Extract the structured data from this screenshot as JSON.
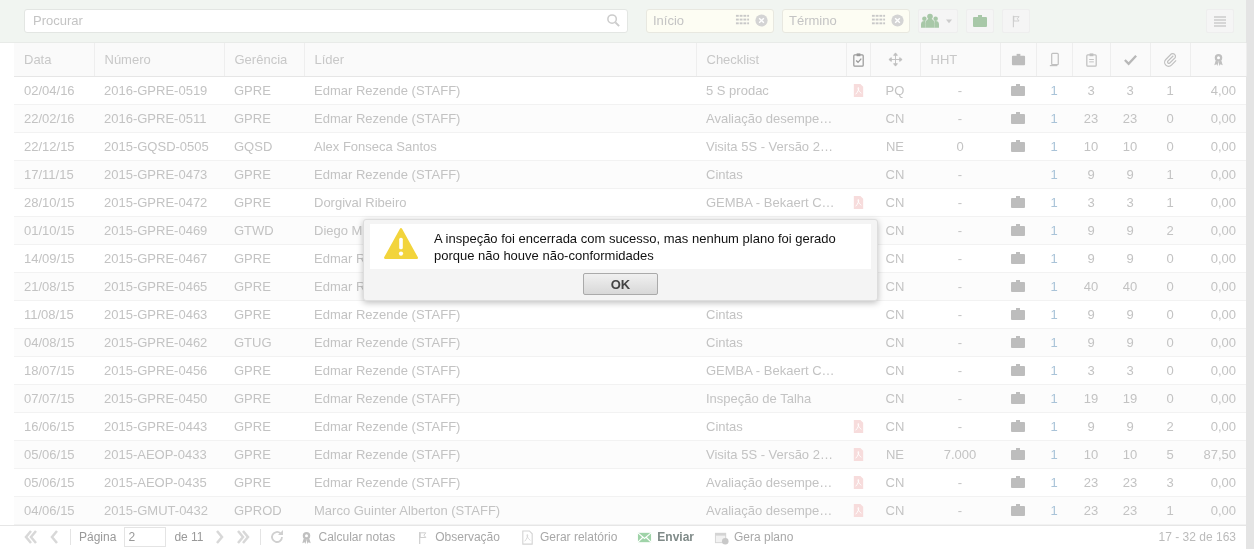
{
  "toolbar": {
    "search": {
      "placeholder": "Procurar"
    },
    "date_from": {
      "placeholder": "Início"
    },
    "date_to": {
      "placeholder": "Término"
    }
  },
  "table": {
    "columns": [
      {
        "kind": "text",
        "label": "Data"
      },
      {
        "kind": "text",
        "label": "Número"
      },
      {
        "kind": "text",
        "label": "Gerência"
      },
      {
        "kind": "text",
        "label": "Líder"
      },
      {
        "kind": "text",
        "label": "Checklist"
      },
      {
        "kind": "icon"
      },
      {
        "kind": "icon"
      },
      {
        "kind": "text",
        "label": "HHT"
      },
      {
        "kind": "icon"
      },
      {
        "kind": "icon"
      },
      {
        "kind": "icon"
      },
      {
        "kind": "icon"
      },
      {
        "kind": "icon"
      },
      {
        "kind": "icon"
      }
    ],
    "rows": [
      {
        "date": "02/04/16",
        "number": "2016-GPRE-0519",
        "unit": "GPRE",
        "leader": "Edmar Rezende (STAFF)",
        "checklist": "5 S prodac",
        "report": true,
        "type": "PQ",
        "hht": "-",
        "kit": true,
        "c1": "1",
        "c2": "3",
        "c3": "3",
        "c4": "1",
        "c5": "4,00"
      },
      {
        "date": "22/02/16",
        "number": "2016-GPRE-0511",
        "unit": "GPRE",
        "leader": "Edmar Rezende (STAFF)",
        "checklist": "Avaliação desempe…",
        "report": false,
        "type": "CN",
        "hht": "-",
        "kit": true,
        "c1": "1",
        "c2": "23",
        "c3": "23",
        "c4": "0",
        "c5": "0,00"
      },
      {
        "date": "22/12/15",
        "number": "2015-GQSD-0505",
        "unit": "GQSD",
        "leader": "Alex Fonseca Santos",
        "checklist": "Visita 5S - Versão 2…",
        "report": false,
        "type": "NE",
        "hht": "0",
        "kit": true,
        "c1": "1",
        "c2": "10",
        "c3": "10",
        "c4": "0",
        "c5": "0,00"
      },
      {
        "date": "17/11/15",
        "number": "2015-GPRE-0473",
        "unit": "GPRE",
        "leader": "Edmar Rezende (STAFF)",
        "checklist": "Cintas",
        "report": false,
        "type": "CN",
        "hht": "-",
        "kit": false,
        "c1": "1",
        "c2": "9",
        "c3": "9",
        "c4": "1",
        "c5": "0,00"
      },
      {
        "date": "28/10/15",
        "number": "2015-GPRE-0472",
        "unit": "GPRE",
        "leader": "Dorgival Ribeiro",
        "checklist": "GEMBA - Bekaert C…",
        "report": true,
        "type": "CN",
        "hht": "-",
        "kit": true,
        "c1": "1",
        "c2": "3",
        "c3": "3",
        "c4": "1",
        "c5": "0,00"
      },
      {
        "date": "01/10/15",
        "number": "2015-GPRE-0469",
        "unit": "GTWD",
        "leader": "Diego M",
        "report": false,
        "type": "CN",
        "hht": "-",
        "kit": true,
        "c1": "1",
        "c2": "9",
        "c3": "9",
        "c4": "2",
        "c5": "0,00"
      },
      {
        "date": "14/09/15",
        "number": "2015-GPRE-0467",
        "unit": "GPRE",
        "leader": "Edmar R",
        "report": false,
        "type": "CN",
        "hht": "-",
        "kit": true,
        "c1": "1",
        "c2": "9",
        "c3": "9",
        "c4": "0",
        "c5": "0,00"
      },
      {
        "date": "21/08/15",
        "number": "2015-GPRE-0465",
        "unit": "GPRE",
        "leader": "Edmar R",
        "report": false,
        "type": "CN",
        "hht": "-",
        "kit": true,
        "c1": "1",
        "c2": "40",
        "c3": "40",
        "c4": "0",
        "c5": "0,00"
      },
      {
        "date": "11/08/15",
        "number": "2015-GPRE-0463",
        "unit": "GPRE",
        "leader": "Edmar Rezende (STAFF)",
        "checklist": "Cintas",
        "report": false,
        "type": "CN",
        "hht": "-",
        "kit": true,
        "c1": "1",
        "c2": "9",
        "c3": "9",
        "c4": "0",
        "c5": "0,00"
      },
      {
        "date": "04/08/15",
        "number": "2015-GPRE-0462",
        "unit": "GTUG",
        "leader": "Edmar Rezende (STAFF)",
        "checklist": "Cintas",
        "report": false,
        "type": "CN",
        "hht": "-",
        "kit": true,
        "c1": "1",
        "c2": "9",
        "c3": "9",
        "c4": "0",
        "c5": "0,00"
      },
      {
        "date": "18/07/15",
        "number": "2015-GPRE-0456",
        "unit": "GPRE",
        "leader": "Edmar Rezende (STAFF)",
        "checklist": "GEMBA - Bekaert C…",
        "report": false,
        "type": "CN",
        "hht": "-",
        "kit": true,
        "c1": "1",
        "c2": "3",
        "c3": "3",
        "c4": "0",
        "c5": "0,00"
      },
      {
        "date": "07/07/15",
        "number": "2015-GPRE-0450",
        "unit": "GPRE",
        "leader": "Edmar Rezende (STAFF)",
        "checklist": "Inspeção de Talha",
        "report": false,
        "type": "CN",
        "hht": "-",
        "kit": true,
        "c1": "1",
        "c2": "19",
        "c3": "19",
        "c4": "0",
        "c5": "0,00"
      },
      {
        "date": "16/06/15",
        "number": "2015-GPRE-0443",
        "unit": "GPRE",
        "leader": "Edmar Rezende (STAFF)",
        "checklist": "Cintas",
        "report": true,
        "type": "CN",
        "hht": "-",
        "kit": true,
        "c1": "1",
        "c2": "9",
        "c3": "9",
        "c4": "2",
        "c5": "0,00"
      },
      {
        "date": "05/06/15",
        "number": "2015-AEOP-0433",
        "unit": "GPRE",
        "leader": "Edmar Rezende (STAFF)",
        "checklist": "Visita 5S - Versão 2…",
        "report": true,
        "type": "NE",
        "hht": "7.000",
        "kit": true,
        "c1": "1",
        "c2": "10",
        "c3": "10",
        "c4": "5",
        "c5": "87,50"
      },
      {
        "date": "05/06/15",
        "number": "2015-AEOP-0435",
        "unit": "GPRE",
        "leader": "Edmar Rezende (STAFF)",
        "checklist": "Avaliação desempe…",
        "report": true,
        "type": "CN",
        "hht": "-",
        "kit": true,
        "c1": "1",
        "c2": "23",
        "c3": "23",
        "c4": "3",
        "c5": "0,00"
      },
      {
        "date": "04/06/15",
        "number": "2015-GMUT-0432",
        "unit": "GPROD",
        "leader": "Marco Guinter Alberton (STAFF)",
        "checklist": "Avaliação desempe…",
        "report": true,
        "type": "CN",
        "hht": "-",
        "kit": true,
        "c1": "1",
        "c2": "23",
        "c3": "23",
        "c4": "1",
        "c5": "0,00"
      }
    ]
  },
  "pager": {
    "page_label": "Página",
    "page": "2",
    "of": "de 11",
    "actions": [
      {
        "label": "Calcular notas",
        "disabled": true
      },
      {
        "label": "Observação",
        "disabled": true
      },
      {
        "label": "Gerar relatório",
        "disabled": true
      },
      {
        "label": "Enviar",
        "disabled": false
      },
      {
        "label": "Gera plano",
        "disabled": true
      }
    ],
    "range": "17 - 32 de 163"
  },
  "dialog": {
    "message": "A inspeção foi encerrada com sucesso, mas nenhum plano foi gerado porque não houve não-conformidades",
    "button": "OK"
  }
}
